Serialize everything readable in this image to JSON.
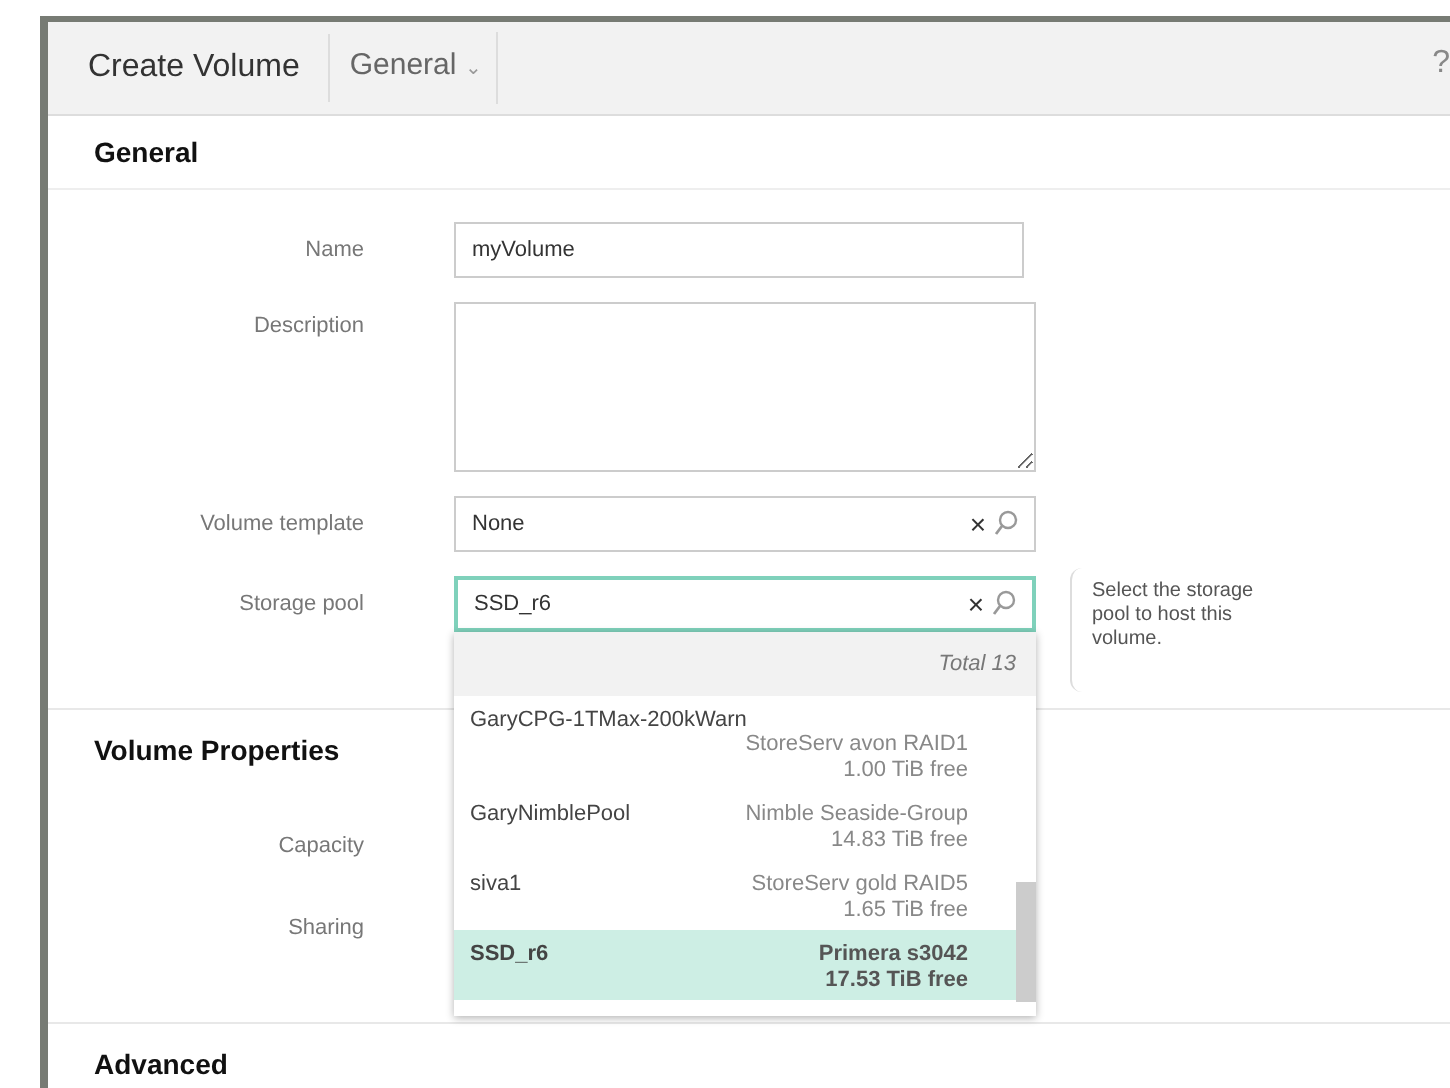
{
  "window": {
    "title": "Create Volume",
    "help": "?"
  },
  "section_menu": {
    "label": "General",
    "caret": "⌄"
  },
  "sections": [
    {
      "title": "General"
    },
    {
      "title": "Volume Properties"
    },
    {
      "title": "Advanced"
    }
  ],
  "general_fields": [
    {
      "kind": "text",
      "label": "Name",
      "value": "myVolume"
    },
    {
      "kind": "textarea",
      "label": "Description"
    },
    {
      "kind": "search",
      "label": "Volume template",
      "value": "None",
      "focused": false
    },
    {
      "kind": "search",
      "label": "Storage pool",
      "value": "SSD_r6",
      "focused": true
    }
  ],
  "clear_glyph": "×",
  "help_tip": "Select the storage pool to host this volume.",
  "dropdown": {
    "total": "Total 13",
    "items": [
      {
        "name": "GaryCPG-1TMax-200kWarn",
        "system": "StoreServ avon RAID1",
        "free": "1.00 TiB free",
        "selected": false
      },
      {
        "name": "GaryNimblePool",
        "system": "Nimble Seaside-Group",
        "free": "14.83 TiB free",
        "selected": false
      },
      {
        "name": "siva1",
        "system": "StoreServ gold RAID5",
        "free": "1.65 TiB free",
        "selected": false
      },
      {
        "name": "SSD_r6",
        "system": "Primera s3042",
        "free": "17.53 TiB free",
        "selected": true
      }
    ]
  },
  "property_fields": [
    {
      "label": "Capacity"
    },
    {
      "label": "Sharing"
    }
  ]
}
